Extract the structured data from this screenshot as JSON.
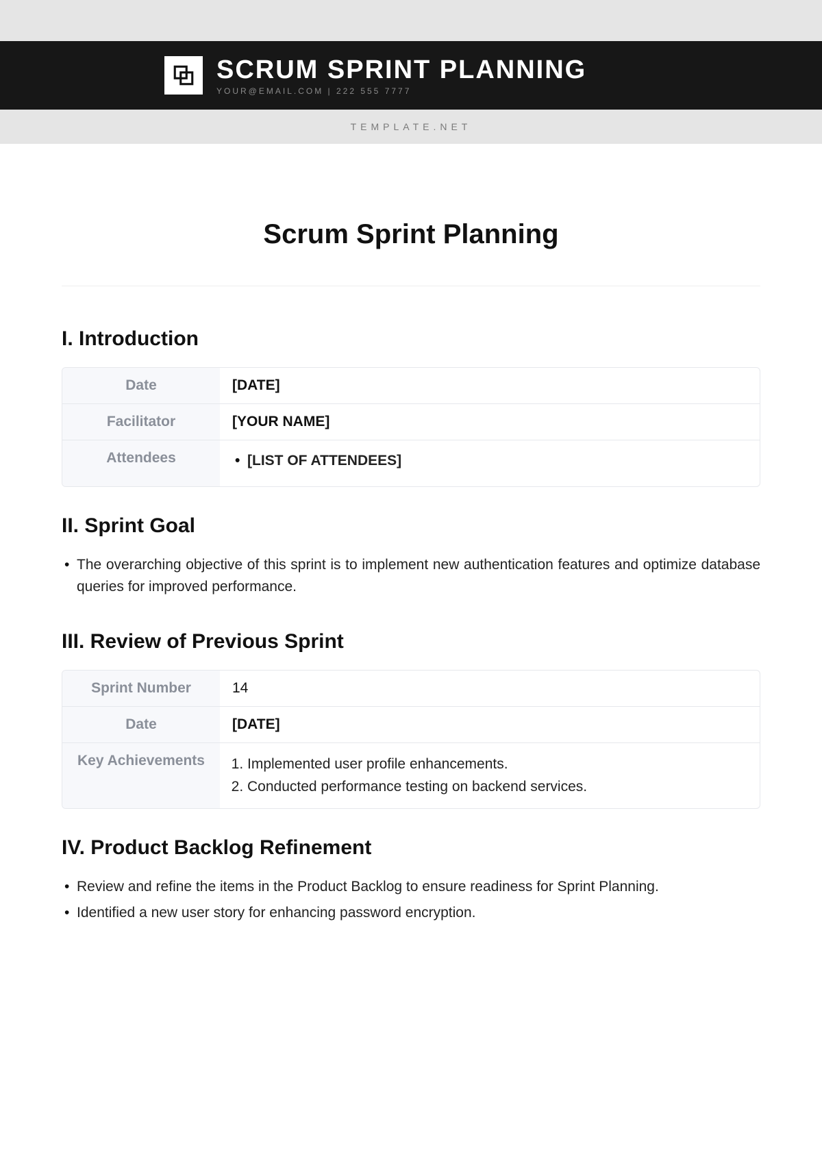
{
  "banner": {
    "title": "SCRUM SPRINT PLANNING",
    "subline": "YOUR@EMAIL.COM | 222 555 7777",
    "watermark": "TEMPLATE.NET"
  },
  "doc": {
    "title": "Scrum Sprint Planning"
  },
  "sections": {
    "intro": {
      "heading": "I. Introduction",
      "rows": {
        "date_label": "Date",
        "date_value": "[DATE]",
        "facilitator_label": "Facilitator",
        "facilitator_value": "[YOUR NAME]",
        "attendees_label": "Attendees",
        "attendees_value": "[LIST OF ATTENDEES]"
      }
    },
    "goal": {
      "heading": "II. Sprint Goal",
      "item": "The overarching objective of this sprint is to implement new authentication features and optimize database queries for improved performance."
    },
    "review": {
      "heading": "III. Review of Previous Sprint",
      "rows": {
        "num_label": "Sprint Number",
        "num_value": "14",
        "date_label": "Date",
        "date_value": "[DATE]",
        "ach_label": "Key Achievements",
        "ach1": "Implemented user profile enhancements.",
        "ach2": "Conducted performance testing on backend services."
      }
    },
    "backlog": {
      "heading": "IV. Product Backlog Refinement",
      "item1": "Review and refine the items in the Product Backlog to ensure readiness for Sprint Planning.",
      "item2": "Identified a new user story for enhancing password encryption."
    }
  }
}
